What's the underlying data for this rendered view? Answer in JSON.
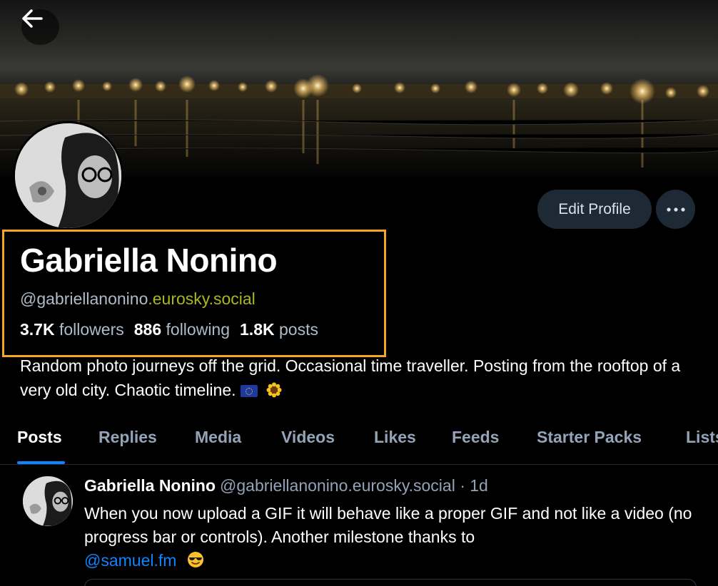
{
  "header": {
    "back_icon": "arrow-left-icon",
    "edit_profile_label": "Edit Profile",
    "more_icon": "ellipsis-icon"
  },
  "profile": {
    "display_name": "Gabriella Nonino",
    "handle_user": "@gabriellanonino",
    "handle_domain": ".eurosky.social",
    "stats": [
      {
        "count": "3.7K",
        "label": "followers"
      },
      {
        "count": "886",
        "label": "following"
      },
      {
        "count": "1.8K",
        "label": "posts"
      }
    ],
    "bio": "Random photo journeys off the grid. Occasional time traveller. Posting from the rooftop of a very old city. Chaotic timeline.",
    "bio_emojis": [
      "eu-flag-icon",
      "sunflower-icon"
    ]
  },
  "tabs": [
    {
      "label": "Posts",
      "active": true
    },
    {
      "label": "Replies",
      "active": false
    },
    {
      "label": "Media",
      "active": false
    },
    {
      "label": "Videos",
      "active": false
    },
    {
      "label": "Likes",
      "active": false
    },
    {
      "label": "Feeds",
      "active": false
    },
    {
      "label": "Starter Packs",
      "active": false
    },
    {
      "label": "Lists",
      "active": false
    }
  ],
  "post": {
    "author": "Gabriella Nonino",
    "handle": "@gabriellanonino.eurosky.social",
    "separator": "·",
    "time": "1d",
    "text": "When you now upload a GIF it will behave like a proper GIF and not like a video (no progress bar or controls). Another milestone thanks to",
    "mention": "@samuel.fm",
    "emoji": "sunglasses-face-icon"
  },
  "colors": {
    "background": "#000000",
    "accent_blue": "#1083fe",
    "muted_text": "#93a3b8",
    "handle_domain": "#a8b81e",
    "highlight_box": "#f5a623",
    "button_bg": "#1e2936"
  }
}
